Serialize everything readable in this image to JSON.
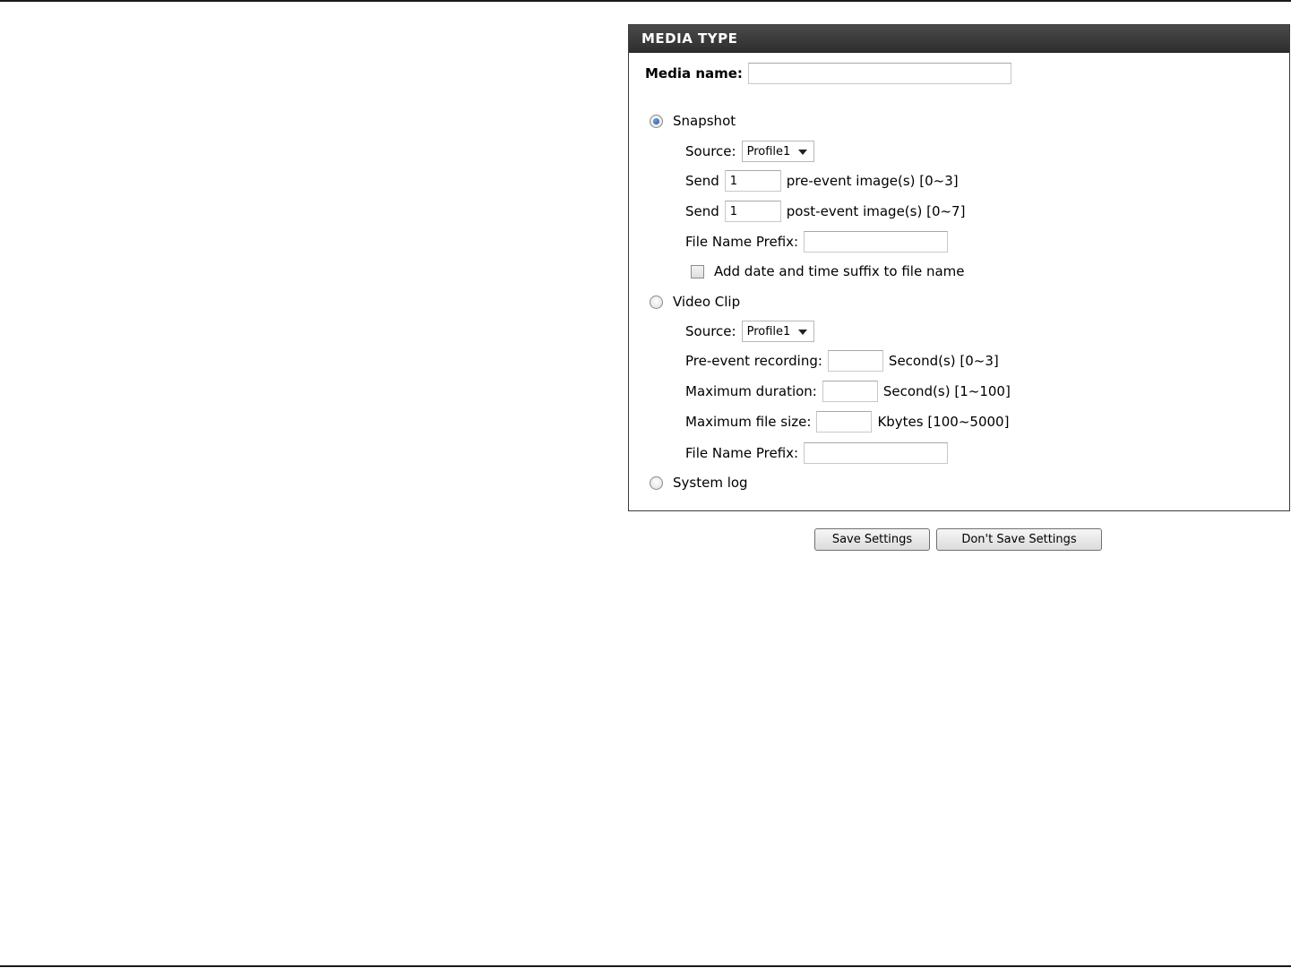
{
  "panel": {
    "title": "MEDIA TYPE",
    "media_name_label": "Media name:",
    "media_name_value": ""
  },
  "snapshot": {
    "label": "Snapshot",
    "selected": true,
    "source_label": "Source:",
    "source_value": "Profile1",
    "send_label": "Send",
    "pre_value": "1",
    "pre_suffix": "pre-event image(s) [0~3]",
    "post_value": "1",
    "post_suffix": "post-event image(s) [0~7]",
    "prefix_label": "File Name Prefix:",
    "prefix_value": "",
    "suffix_checkbox_label": "Add date and time suffix to file name"
  },
  "video_clip": {
    "label": "Video Clip",
    "selected": false,
    "source_label": "Source:",
    "source_value": "Profile1",
    "pre_recording_label": "Pre-event recording:",
    "pre_recording_value": "",
    "pre_recording_suffix": "Second(s) [0~3]",
    "max_duration_label": "Maximum duration:",
    "max_duration_value": "",
    "max_duration_suffix": "Second(s) [1~100]",
    "max_size_label": "Maximum file size:",
    "max_size_value": "",
    "max_size_suffix": "Kbytes [100~5000]",
    "prefix_label": "File Name Prefix:",
    "prefix_value": ""
  },
  "system_log": {
    "label": "System log",
    "selected": false
  },
  "buttons": {
    "save": "Save Settings",
    "dont_save": "Don't Save Settings"
  }
}
